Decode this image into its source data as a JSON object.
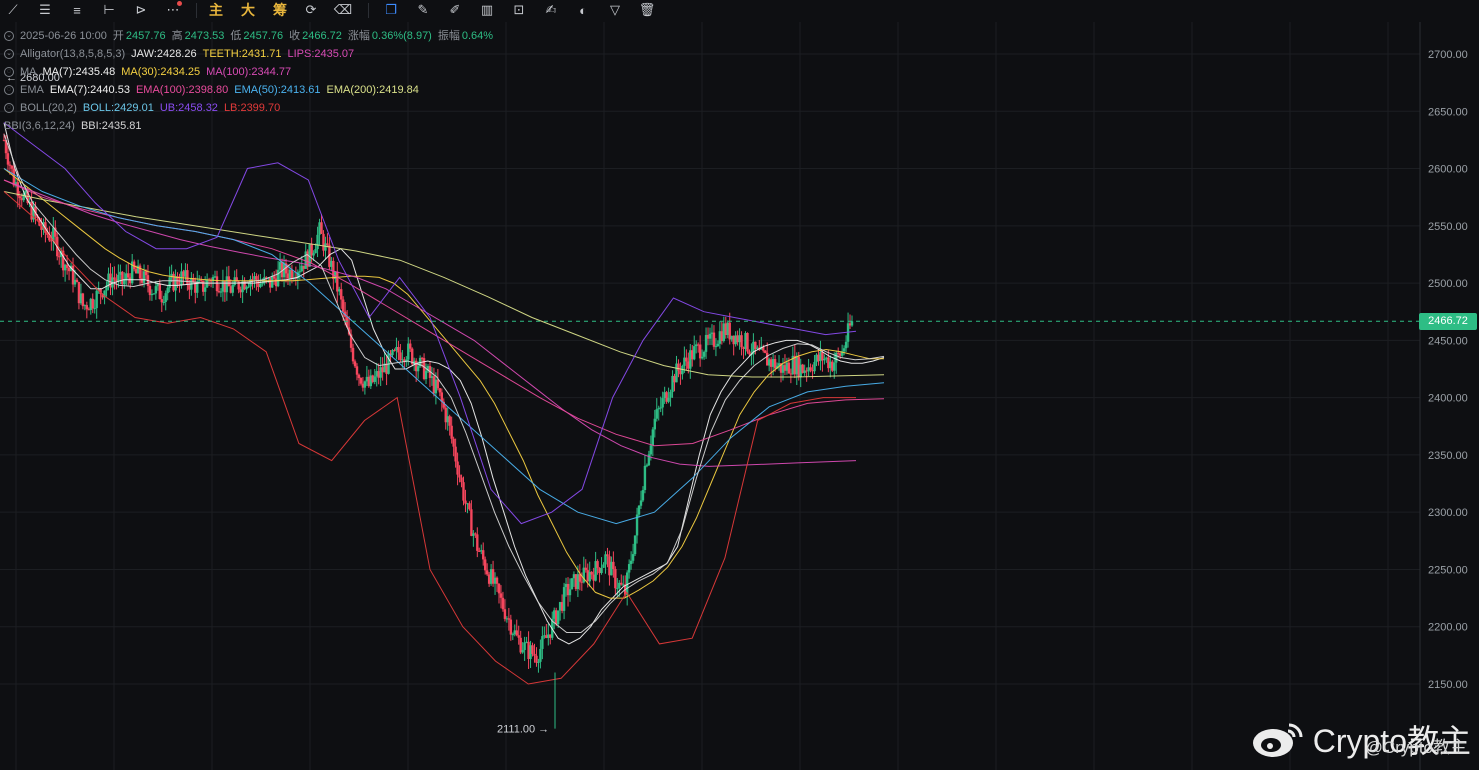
{
  "toolbar": {
    "tools": [
      {
        "icon": "trendline-icon",
        "glyph": "⟋"
      },
      {
        "icon": "horizontal-lines-icon",
        "glyph": "☰"
      },
      {
        "icon": "parallel-lines-icon",
        "glyph": "≡"
      },
      {
        "icon": "horizontal-ray-icon",
        "glyph": "⊢"
      },
      {
        "icon": "arrow-tool-icon",
        "glyph": "⊳"
      },
      {
        "icon": "more-tools-icon",
        "glyph": "⋯"
      }
    ],
    "cn_labels": [
      "主",
      "大",
      "筹"
    ],
    "right_tools": [
      {
        "icon": "cycle-icon",
        "glyph": "⟳"
      },
      {
        "icon": "eraser-icon",
        "glyph": "⌫"
      },
      {
        "icon": "copy-icon",
        "glyph": "❐"
      },
      {
        "icon": "ruler-icon",
        "glyph": "✎"
      },
      {
        "icon": "pen-icon",
        "glyph": "✐"
      },
      {
        "icon": "candles-icon",
        "glyph": "▥"
      },
      {
        "icon": "lock-icon",
        "glyph": "⊡"
      },
      {
        "icon": "edit-icon",
        "glyph": "✍"
      },
      {
        "icon": "magnet-icon",
        "glyph": "◐"
      },
      {
        "icon": "filter-icon",
        "glyph": "▽"
      },
      {
        "icon": "trash-icon",
        "glyph": "🗑"
      }
    ]
  },
  "legend": {
    "ohlc": {
      "datetime": "2025-06-26 10:00",
      "open_label": "开",
      "open": "2457.76",
      "high_label": "高",
      "high": "2473.53",
      "low_label": "低",
      "low": "2457.76",
      "close_label": "收",
      "close": "2466.72",
      "change_label": "涨幅",
      "change": "0.36%(8.97)",
      "amp_label": "振幅",
      "amp": "0.64%"
    },
    "alligator": {
      "name": "Alligator(13,8,5,8,5,3)",
      "jaw": "JAW:2428.26",
      "teeth": "TEETH:2431.71",
      "lips": "LIPS:2435.07"
    },
    "ma": {
      "name": "MA",
      "ma7": "MA(7):2435.48",
      "ma30": "MA(30):2434.25",
      "ma100": "MA(100):2344.77"
    },
    "ema": {
      "name": "EMA",
      "ema7": "EMA(7):2440.53",
      "ema100": "EMA(100):2398.80",
      "ema50": "EMA(50):2413.61",
      "ema200": "EMA(200):2419.84"
    },
    "boll": {
      "name": "BOLL(20,2)",
      "mid": "BOLL:2429.01",
      "ub": "UB:2458.32",
      "lb": "LB:2399.70"
    },
    "bbi": {
      "name": "BBI(3,6,12,24)",
      "val": "BBI:2435.81"
    }
  },
  "colors": {
    "bull": "#2ebd85",
    "bear": "#f6465d",
    "bg": "#0e0f12",
    "grid": "#1c1e22",
    "ma7": "#f0f0f0",
    "ma30": "#f5d142",
    "ma100": "#d84bb5",
    "ema100": "#e84b9c",
    "ema50": "#4bb3f0",
    "ema200": "#d9e08a",
    "boll": "#6bc6e8",
    "ub": "#8a4cf0",
    "lb": "#e23a3a",
    "bbi": "#d5d5d5"
  },
  "last_price": "2466.72",
  "watermark": {
    "text": "Crypto教主",
    "sub": "@Crypto教主"
  },
  "chart_data": {
    "type": "candlestick",
    "y_axis_ticks": [
      "2700.00",
      "2650.00",
      "2600.00",
      "2550.00",
      "2500.00",
      "2450.00",
      "2400.00",
      "2350.00",
      "2300.00",
      "2250.00",
      "2200.00",
      "2150.00"
    ],
    "ylim": [
      2100,
      2725
    ],
    "high_marker": "2680.00",
    "low_marker": "2111.00",
    "last_price": 2466.72,
    "close_path": [
      2625,
      2590,
      2575,
      2560,
      2545,
      2540,
      2520,
      2505,
      2480,
      2485,
      2495,
      2505,
      2500,
      2510,
      2505,
      2495,
      2490,
      2500,
      2505,
      2500,
      2495,
      2505,
      2500,
      2495,
      2500,
      2505,
      2500,
      2500,
      2510,
      2510,
      2515,
      2525,
      2545,
      2520,
      2490,
      2450,
      2420,
      2410,
      2420,
      2430,
      2440,
      2440,
      2430,
      2420,
      2405,
      2380,
      2340,
      2300,
      2270,
      2250,
      2230,
      2210,
      2190,
      2180,
      2175,
      2190,
      2210,
      2230,
      2240,
      2245,
      2250,
      2260,
      2240,
      2230,
      2280,
      2340,
      2380,
      2400,
      2420,
      2430,
      2440,
      2445,
      2450,
      2460,
      2455,
      2450,
      2440,
      2435,
      2430,
      2425,
      2430,
      2425,
      2430,
      2435,
      2430,
      2440,
      2466.72
    ],
    "series": [
      {
        "name": "MA(7)",
        "values": [
          2640,
          2600,
          2575,
          2560,
          2545,
          2530,
          2515,
          2505,
          2495,
          2495,
          2500,
          2503,
          2503,
          2503,
          2500,
          2498,
          2498,
          2499,
          2500,
          2500,
          2500,
          2500,
          2500,
          2500,
          2501,
          2502,
          2503,
          2505,
          2510,
          2515,
          2525,
          2530,
          2520,
          2490,
          2460,
          2440,
          2425,
          2425,
          2430,
          2432,
          2430,
          2425,
          2415,
          2395,
          2365,
          2330,
          2300,
          2270,
          2245,
          2225,
          2205,
          2190,
          2185,
          2190,
          2200,
          2215,
          2225,
          2235,
          2240,
          2245,
          2250,
          2255,
          2270,
          2310,
          2350,
          2385,
          2405,
          2420,
          2430,
          2440,
          2445,
          2448,
          2450,
          2450,
          2447,
          2442,
          2436,
          2432,
          2430,
          2430,
          2432,
          2435
        ]
      },
      {
        "name": "MA(30)",
        "values": [
          2600,
          2590,
          2580,
          2570,
          2560,
          2550,
          2540,
          2530,
          2522,
          2515,
          2510,
          2507,
          2505,
          2504,
          2503,
          2502,
          2502,
          2502,
          2502,
          2502,
          2502,
          2503,
          2504,
          2505,
          2506,
          2506,
          2505,
          2500,
          2490,
          2475,
          2460,
          2445,
          2430,
          2415,
          2395,
          2370,
          2345,
          2315,
          2290,
          2265,
          2245,
          2230,
          2225,
          2225,
          2232,
          2240,
          2252,
          2270,
          2295,
          2325,
          2355,
          2385,
          2405,
          2420,
          2430,
          2436,
          2440,
          2442,
          2440,
          2437,
          2434,
          2434
        ]
      },
      {
        "name": "MA(100)",
        "values": [
          2590,
          2580,
          2570,
          2560,
          2552,
          2545,
          2538,
          2532,
          2527,
          2522,
          2518,
          2512,
          2505,
          2495,
          2480,
          2465,
          2450,
          2430,
          2410,
          2390,
          2372,
          2358,
          2348,
          2342,
          2340,
          2341,
          2342,
          2343,
          2344,
          2345
        ]
      },
      {
        "name": "EMA(200)",
        "values": [
          2580,
          2572,
          2565,
          2558,
          2552,
          2546,
          2540,
          2534,
          2528,
          2520,
          2505,
          2488,
          2470,
          2455,
          2440,
          2428,
          2420,
          2418,
          2418,
          2419,
          2420
        ]
      },
      {
        "name": "EMA(100)",
        "values": [
          2590,
          2575,
          2565,
          2557,
          2550,
          2545,
          2538,
          2530,
          2518,
          2500,
          2480,
          2460,
          2440,
          2420,
          2400,
          2382,
          2368,
          2358,
          2360,
          2372,
          2385,
          2395,
          2398,
          2399
        ]
      },
      {
        "name": "EMA(50)",
        "values": [
          2600,
          2580,
          2567,
          2557,
          2550,
          2545,
          2538,
          2525,
          2500,
          2470,
          2440,
          2410,
          2380,
          2350,
          2320,
          2300,
          2290,
          2300,
          2330,
          2365,
          2392,
          2405,
          2410,
          2413
        ]
      },
      {
        "name": "BOLL UB",
        "values": [
          2640,
          2620,
          2600,
          2570,
          2545,
          2530,
          2530,
          2540,
          2600,
          2605,
          2590,
          2520,
          2470,
          2505,
          2470,
          2400,
          2320,
          2290,
          2300,
          2320,
          2400,
          2450,
          2487,
          2475,
          2470,
          2465,
          2460,
          2455,
          2458
        ]
      },
      {
        "name": "BOLL LB",
        "values": [
          2580,
          2555,
          2520,
          2490,
          2470,
          2465,
          2470,
          2460,
          2440,
          2360,
          2345,
          2380,
          2400,
          2250,
          2200,
          2170,
          2150,
          2155,
          2185,
          2230,
          2185,
          2190,
          2260,
          2380,
          2395,
          2400,
          2400
        ]
      },
      {
        "name": "BBI",
        "values": [
          2630,
          2595,
          2570,
          2555,
          2540,
          2525,
          2512,
          2503,
          2498,
          2497,
          2500,
          2502,
          2502,
          2501,
          2500,
          2500,
          2500,
          2501,
          2503,
          2508,
          2518,
          2525,
          2515,
          2485,
          2455,
          2435,
          2428,
          2430,
          2432,
          2428,
          2418,
          2400,
          2370,
          2335,
          2300,
          2270,
          2245,
          2222,
          2205,
          2195,
          2195,
          2205,
          2220,
          2232,
          2240,
          2246,
          2256,
          2285,
          2330,
          2370,
          2398,
          2415,
          2428,
          2437,
          2443,
          2447,
          2446,
          2440,
          2435,
          2433,
          2434,
          2436
        ]
      }
    ]
  }
}
